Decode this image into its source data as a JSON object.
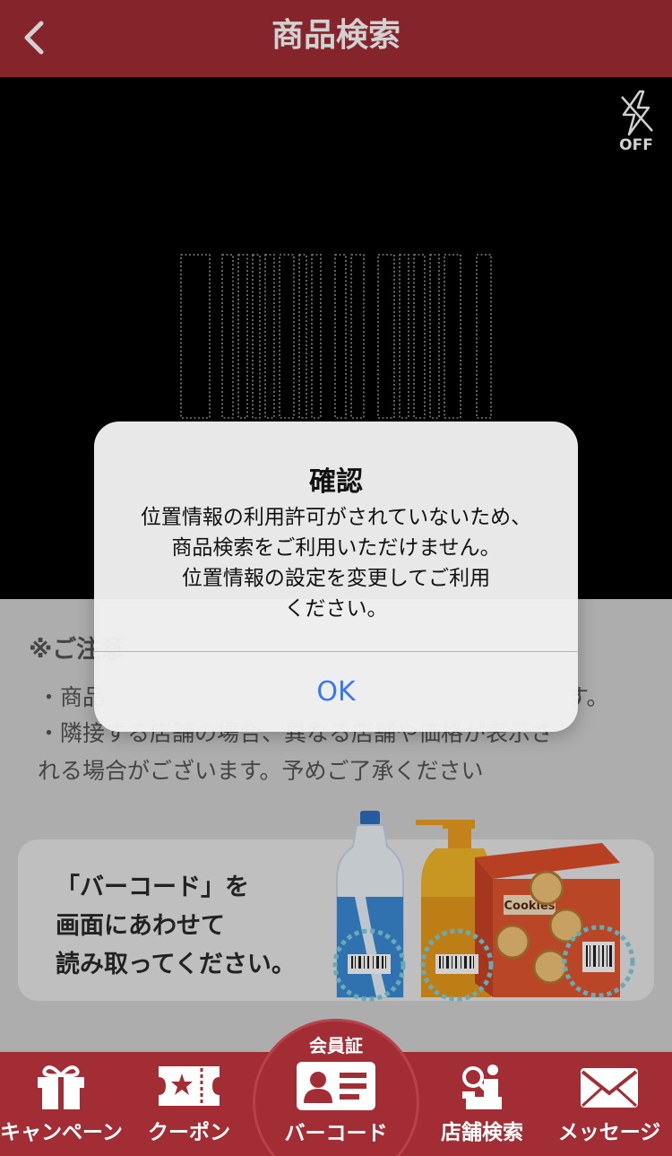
{
  "header": {
    "title": "商品検索"
  },
  "camera": {
    "flash_label": "OFF"
  },
  "notice": {
    "title": "※ご注意",
    "lines": [
      "・商品",
      "・隣接する店舗の場合、異なる店舗や価格が表示さ",
      "れる場合がございます。予めご了承ください"
    ],
    "lines_tail": "す。"
  },
  "scan_card": {
    "line1": "「バーコード」を",
    "line2": "画面にあわせて",
    "line3": "読み取ってください。",
    "cookies_label": "Cookies"
  },
  "alert": {
    "title": "確認",
    "message": "位置情報の利用許可がされていないため、\n商品検索をご利用いただけません。\n位置情報の設定を変更してご利用\nください。",
    "ok_label": "OK"
  },
  "tabbar": {
    "campaign": "キャンペーン",
    "coupon": "クーポン",
    "member_top": "会員証",
    "barcode": "バーコード",
    "store_search": "店舗検索",
    "message": "メッセージ"
  },
  "colors": {
    "brand": "#a32d35",
    "alert_button": "#3478f6"
  }
}
